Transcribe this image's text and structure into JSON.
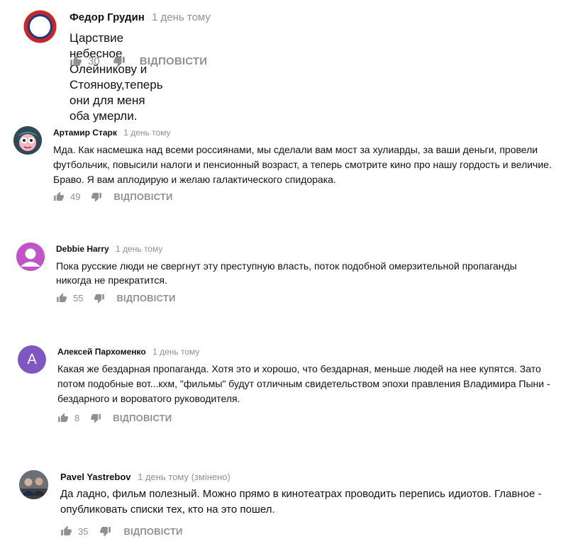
{
  "reply_label": "ВІДПОВІСТИ",
  "comments": [
    {
      "author": "Федор Грудин",
      "time": "1 день тому",
      "text": "Царствие небесное Олейникову и Стоянову,теперь они для меня оба умерли.",
      "likes": "30",
      "avatar_icon": "roundel-icon"
    },
    {
      "author": "Артамир Старк",
      "time": "1 день тому",
      "text": "Мда. Как насмешка над всеми россиянами, мы сделали вам мост за хулиарды, за ваши деньги, провели футбольчик, повысили налоги и пенсионный возраст, а теперь смотрите кино про нашу гордость и величие. Браво. Я вам аплодирую и желаю галактического спидорака.",
      "likes": "49",
      "avatar_icon": "cartoon-avatar-icon"
    },
    {
      "author": "Debbie Harry",
      "time": "1 день тому",
      "text": "Пока русские люди не свергнут эту преступную власть,  поток подобной омерзительной пропаганды никогда не прекратится.",
      "likes": "55",
      "avatar_icon": "default-person-icon",
      "avatar_color": "#c054c8"
    },
    {
      "author": "Алексей Пархоменко",
      "time": "1 день тому",
      "text": "Какая же бездарная пропаганда. Хотя это и хорошо, что бездарная, меньше людей на нее купятся. Зато потом подобные вот...кхм, \"фильмы\" будут отличным свидетельством эпохи правления Владимира Пыни - бездарного и вороватого руководителя.",
      "likes": "8",
      "avatar_letter": "А",
      "avatar_color": "#7e57c2"
    },
    {
      "author": "Pavel Yastrebov",
      "time": "1 день тому (змінено)",
      "text": "Да ладно, фильм полезный. Можно прямо в кинотеатрах проводить перепись идиотов. Главное - опубликовать списки тех, кто на это пошел.",
      "likes": "35",
      "avatar_icon": "photo-avatar-icon"
    }
  ],
  "colors": {
    "meta": "#909090",
    "text": "#111111",
    "roundel_red": "#c62828",
    "roundel_blue": "#1a3b8c"
  }
}
